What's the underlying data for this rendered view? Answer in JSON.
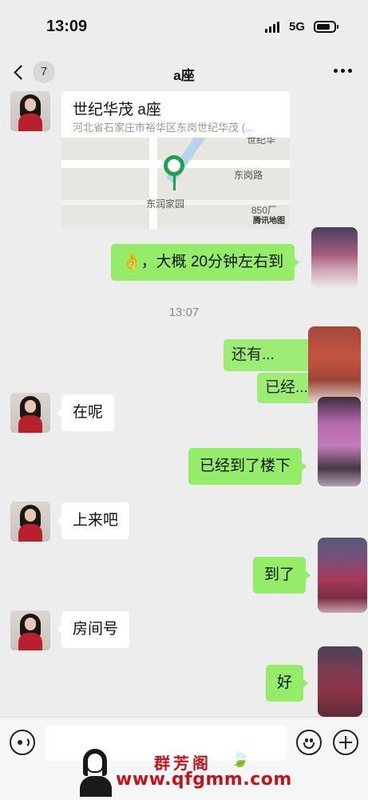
{
  "status_bar": {
    "time": "13:09",
    "network": "5G"
  },
  "nav": {
    "unread_count": "7",
    "title": "a座"
  },
  "location_card": {
    "title": "世纪华茂 a座",
    "address": "河北省石家庄市裕华区东岗世纪华茂 (...",
    "map_labels": {
      "road": "东岗路",
      "estate": "东润家园",
      "poi": "850厂",
      "top_poi": "世纪华",
      "provider": "腾讯地图"
    }
  },
  "messages": [
    {
      "side": "out",
      "emoji": "👌",
      "text": "，大概 20分钟左右到"
    },
    {
      "side": "out",
      "text": "还有..."
    },
    {
      "side": "out",
      "text": "已经..."
    },
    {
      "side": "in",
      "text": "在呢"
    },
    {
      "side": "out",
      "text": "已经到了楼下"
    },
    {
      "side": "in",
      "text": "上来吧"
    },
    {
      "side": "out",
      "text": "到了"
    },
    {
      "side": "in",
      "text": "房间号"
    },
    {
      "side": "out",
      "text": "好"
    }
  ],
  "timestamp": "13:07",
  "watermark": {
    "site": "群芳阁",
    "url": "www.qfgmm.com"
  },
  "icons": [
    "back-chevron-icon",
    "more-icon",
    "voice-icon",
    "emoji-icon",
    "plus-icon",
    "map-pin-icon"
  ],
  "colors": {
    "out_bubble": "#95ec69",
    "in_bubble": "#ffffff",
    "background": "#ededed",
    "pin": "#21a150",
    "watermark": "#c4141b"
  }
}
